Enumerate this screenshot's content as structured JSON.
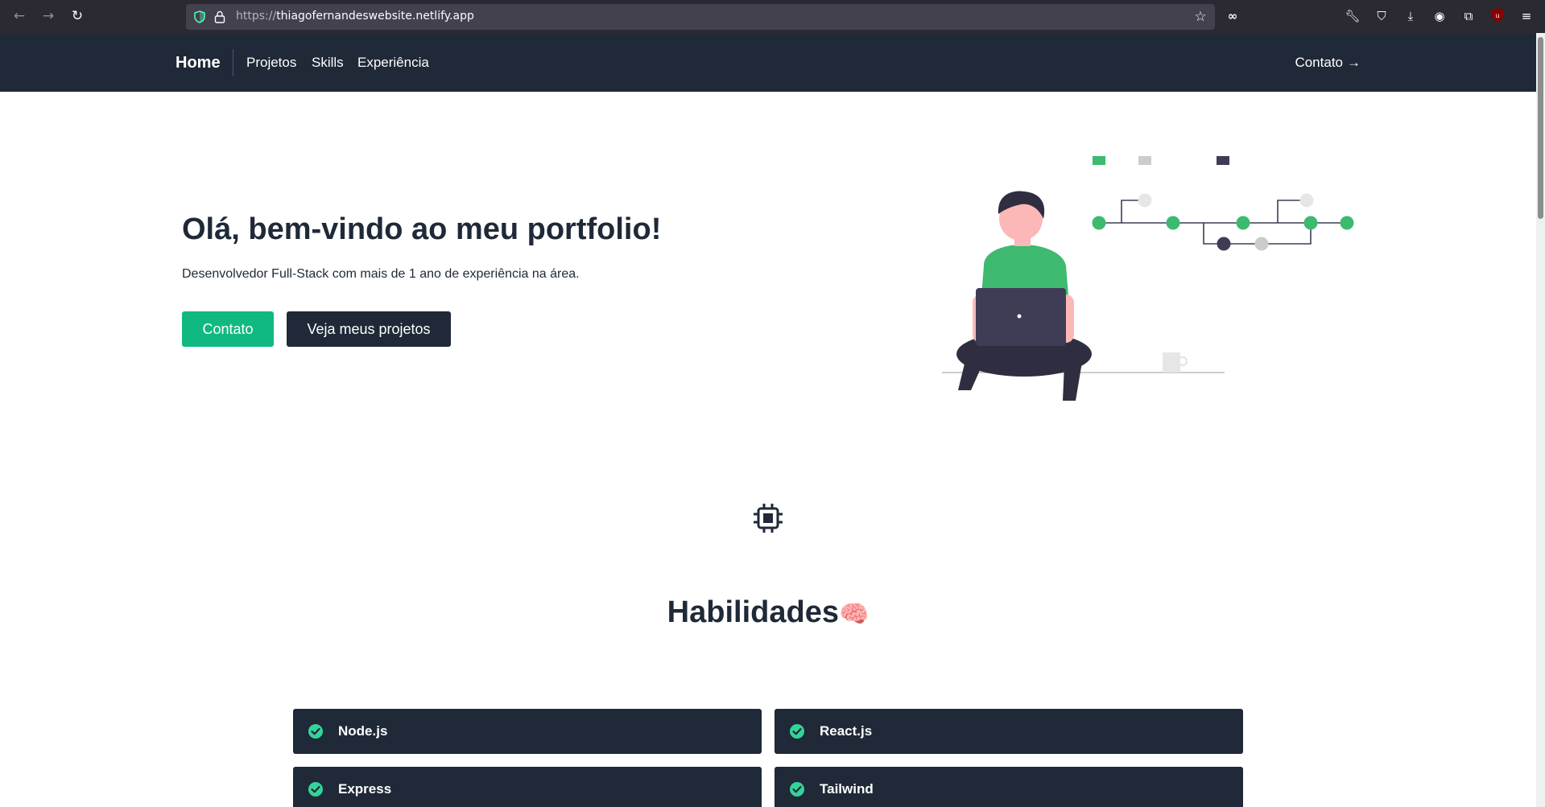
{
  "browser": {
    "url_prefix": "https://",
    "url_host": "thiagofernandeswebsite.netlify.app",
    "back_icon": "arrow-left-icon",
    "forward_icon": "arrow-right-icon",
    "reload_icon": "reload-icon"
  },
  "nav": {
    "brand": "Home",
    "links": [
      "Projetos",
      "Skills",
      "Experiência"
    ],
    "cta": "Contato",
    "cta_arrow": "→"
  },
  "hero": {
    "title": "Olá, bem-vindo ao meu portfolio!",
    "subtitle": "Desenvolvedor Full-Stack com mais de 1 ano de experiência na área.",
    "primary_button": "Contato",
    "secondary_button": "Veja meus projetos"
  },
  "skills": {
    "title": "Habilidades",
    "emoji": "🧠",
    "items": [
      {
        "label": "Node.js"
      },
      {
        "label": "React.js"
      },
      {
        "label": "Express"
      },
      {
        "label": "Tailwind"
      }
    ]
  },
  "colors": {
    "navbar": "#1f2937",
    "accent_green": "#10b981",
    "text_dark": "#1f2937",
    "browser_chrome": "#2b2a33"
  }
}
